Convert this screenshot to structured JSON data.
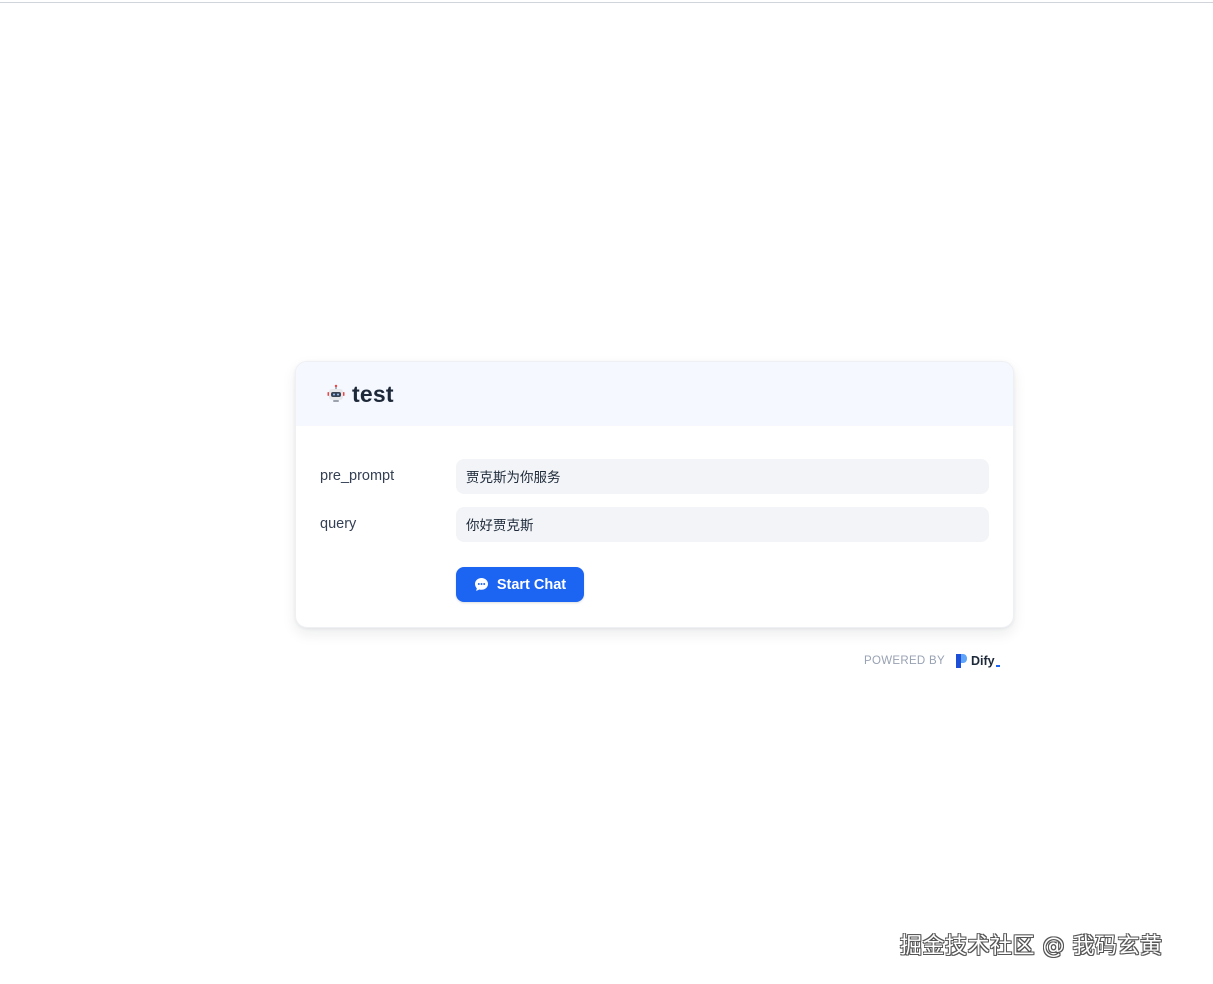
{
  "app": {
    "title": "test",
    "icon": "robot-icon"
  },
  "form": {
    "fields": [
      {
        "label": "pre_prompt",
        "value": "贾克斯为你服务"
      },
      {
        "label": "query",
        "value": "你好贾克斯"
      }
    ],
    "submit_label": "Start Chat",
    "submit_icon": "chat-bubble-icon"
  },
  "footer": {
    "powered_by": "POWERED BY",
    "brand": "Dify"
  },
  "watermark": "掘金技术社区 @ 我码玄黄",
  "colors": {
    "accent": "#1c64f2",
    "header_bg": "#f5f8ff",
    "input_bg": "#f2f4f7"
  }
}
